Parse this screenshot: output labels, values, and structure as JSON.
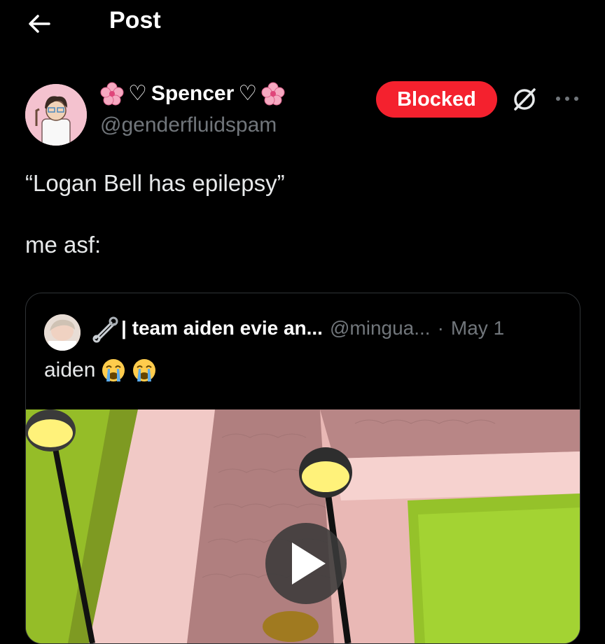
{
  "header": {
    "title": "Post",
    "back_icon": "arrow-left-icon"
  },
  "author": {
    "display_name": "Spencer",
    "decor_left": "♡",
    "decor_right": "♡",
    "handle": "@genderfluidspam",
    "avatar_icon": "avatar-image"
  },
  "actions": {
    "blocked_label": "Blocked",
    "grok_icon": "grok-icon",
    "more_icon": "more-icon"
  },
  "post": {
    "text": "“Logan Bell has epilepsy”\n\nme asf:"
  },
  "quote": {
    "name": "| team aiden evie an...",
    "handle": "@mingua...",
    "separator": "·",
    "date": "May 1",
    "text": "aiden",
    "emoji_icon": "crying-face-icon",
    "media_icon": "play-icon"
  },
  "colors": {
    "background": "#000000",
    "blocked": "#f4212e",
    "secondary_text": "#71767b",
    "border": "#2f3336"
  }
}
